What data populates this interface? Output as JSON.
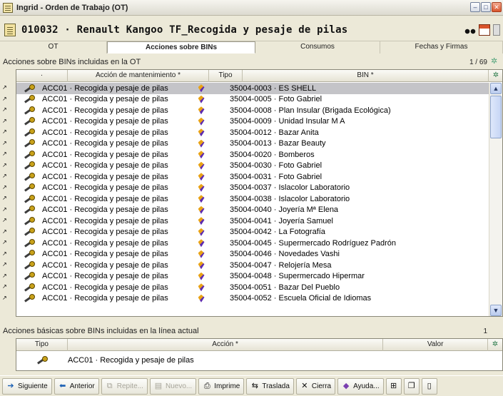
{
  "window": {
    "title": "Ingrid - Orden de Trabajo (OT)",
    "buttons": [
      "–",
      "□",
      "✕"
    ]
  },
  "header": {
    "title": "010032 · Renault Kangoo TF_Recogida y pesaje de pilas"
  },
  "tabs": [
    {
      "label": "OT"
    },
    {
      "label": "Acciones sobre BINs"
    },
    {
      "label": "Consumos"
    },
    {
      "label": "Fechas y Firmas"
    }
  ],
  "bins_section": {
    "title": "Acciones sobre BINs incluidas en la OT",
    "count": "1 / 69",
    "columns": {
      "dot": "·",
      "action": "Acción de mantenimiento *",
      "tipo": "Tipo",
      "bin": "BIN *"
    },
    "rows": [
      {
        "action": "ACC01 · Recogida y pesaje de pilas",
        "bin": "35004-0003 · ES SHELL",
        "selected": true
      },
      {
        "action": "ACC01 · Recogida y pesaje de pilas",
        "bin": "35004-0005 · Foto Gabriel"
      },
      {
        "action": "ACC01 · Recogida y pesaje de pilas",
        "bin": "35004-0008 · Plan Insular (Brigada Ecológica)"
      },
      {
        "action": "ACC01 · Recogida y pesaje de pilas",
        "bin": "35004-0009 · Unidad Insular M A"
      },
      {
        "action": "ACC01 · Recogida y pesaje de pilas",
        "bin": "35004-0012 · Bazar Anita"
      },
      {
        "action": "ACC01 · Recogida y pesaje de pilas",
        "bin": "35004-0013 · Bazar Beauty"
      },
      {
        "action": "ACC01 · Recogida y pesaje de pilas",
        "bin": "35004-0020 · Bomberos"
      },
      {
        "action": "ACC01 · Recogida y pesaje de pilas",
        "bin": "35004-0030 · Foto Gabriel"
      },
      {
        "action": "ACC01 · Recogida y pesaje de pilas",
        "bin": "35004-0031 · Foto Gabriel"
      },
      {
        "action": "ACC01 · Recogida y pesaje de pilas",
        "bin": "35004-0037 · Islacolor Laboratorio"
      },
      {
        "action": "ACC01 · Recogida y pesaje de pilas",
        "bin": "35004-0038 · Islacolor Laboratorio"
      },
      {
        "action": "ACC01 · Recogida y pesaje de pilas",
        "bin": "35004-0040 · Joyería Mª Elena"
      },
      {
        "action": "ACC01 · Recogida y pesaje de pilas",
        "bin": "35004-0041 · Joyería Samuel"
      },
      {
        "action": "ACC01 · Recogida y pesaje de pilas",
        "bin": "35004-0042 · La Fotografía"
      },
      {
        "action": "ACC01 · Recogida y pesaje de pilas",
        "bin": "35004-0045 · Supermercado Rodríguez Padrón"
      },
      {
        "action": "ACC01 · Recogida y pesaje de pilas",
        "bin": "35004-0046 · Novedades Vashi"
      },
      {
        "action": "ACC01 · Recogida y pesaje de pilas",
        "bin": "35004-0047 · Relojería Mesa"
      },
      {
        "action": "ACC01 · Recogida y pesaje de pilas",
        "bin": "35004-0048 · Supermercado Hipermar"
      },
      {
        "action": "ACC01 · Recogida y pesaje de pilas",
        "bin": "35004-0051 · Bazar Del Pueblo"
      },
      {
        "action": "ACC01 · Recogida y pesaje de pilas",
        "bin": "35004-0052 · Escuela Oficial de Idiomas"
      }
    ]
  },
  "basic_section": {
    "title": "Acciones básicas sobre BINs incluidas en la línea actual",
    "count": "1",
    "columns": {
      "tipo": "Tipo",
      "action": "Acción *",
      "valor": "Valor"
    },
    "row": {
      "action": "ACC01 · Recogida y pesaje de pilas",
      "valor": ""
    }
  },
  "toolbar": {
    "siguiente": "Siguiente",
    "anterior": "Anterior",
    "repite": "Repite...",
    "nuevo": "Nuevo...",
    "imprime": "Imprime",
    "traslada": "Traslada",
    "cierra": "Cierra",
    "ayuda": "Ayuda..."
  },
  "colors": {
    "selected_row": "#c4c4c8",
    "background": "#ece9d8",
    "accent_green": "#2a7a4a"
  }
}
